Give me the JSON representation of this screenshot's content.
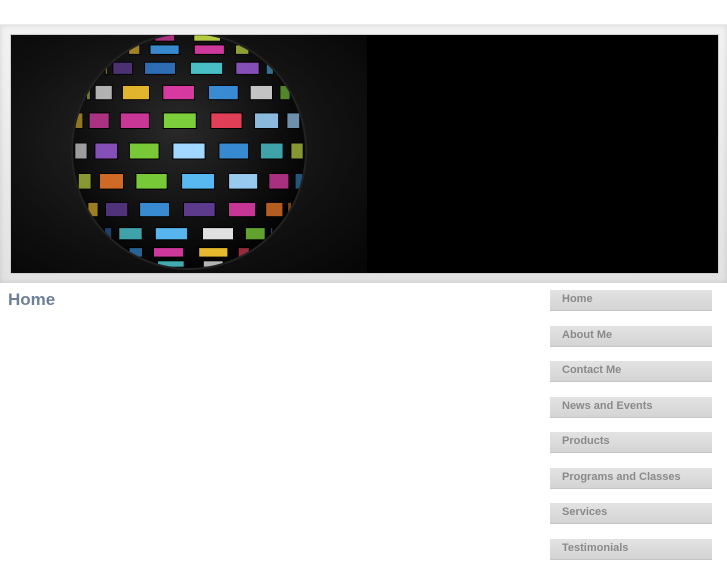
{
  "page": {
    "title": "Home"
  },
  "banner": {
    "image": "globe-of-photo-tiles"
  },
  "nav": {
    "items": [
      {
        "label": "Home"
      },
      {
        "label": "About Me"
      },
      {
        "label": "Contact Me"
      },
      {
        "label": "News and Events"
      },
      {
        "label": "Products"
      },
      {
        "label": "Programs and Classes"
      },
      {
        "label": "Services"
      },
      {
        "label": "Testimonials"
      }
    ]
  },
  "colors": {
    "title": "#6e8099",
    "nav_text": "#8a8a8a",
    "nav_bg": "#dcdcdc",
    "banner_bg": "#000000"
  }
}
